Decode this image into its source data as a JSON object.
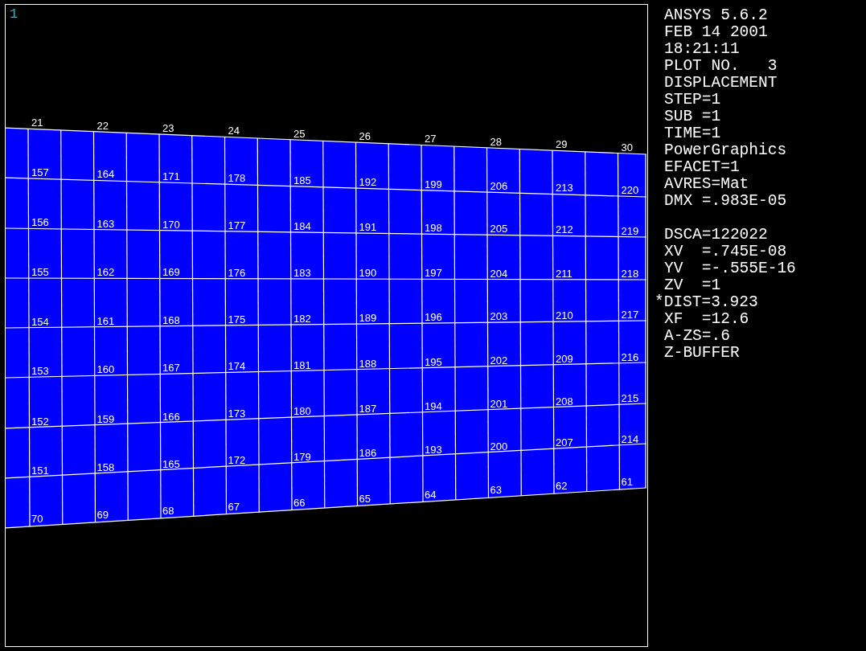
{
  "window_number": "1",
  "mesh": {
    "node_rows": [
      [
        "21",
        "22",
        "23",
        "24",
        "25",
        "26",
        "27",
        "28",
        "29",
        "30"
      ],
      [
        "157",
        "164",
        "171",
        "178",
        "185",
        "192",
        "199",
        "206",
        "213",
        "220"
      ],
      [
        "156",
        "163",
        "170",
        "177",
        "184",
        "191",
        "198",
        "205",
        "212",
        "219"
      ],
      [
        "155",
        "162",
        "169",
        "176",
        "183",
        "190",
        "197",
        "204",
        "211",
        "218"
      ],
      [
        "154",
        "161",
        "168",
        "175",
        "182",
        "189",
        "196",
        "203",
        "210",
        "217"
      ],
      [
        "153",
        "160",
        "167",
        "174",
        "181",
        "188",
        "195",
        "202",
        "209",
        "216"
      ],
      [
        "152",
        "159",
        "166",
        "173",
        "180",
        "187",
        "194",
        "201",
        "208",
        "215"
      ],
      [
        "151",
        "158",
        "165",
        "172",
        "179",
        "186",
        "193",
        "200",
        "207",
        "214"
      ],
      [
        "70",
        "69",
        "68",
        "67",
        "66",
        "65",
        "64",
        "63",
        "62",
        "61"
      ]
    ]
  },
  "legend": {
    "groups": [
      [
        {
          "text": "ANSYS 5.6.2",
          "kind": "plain"
        },
        {
          "text": "FEB 14 2001",
          "kind": "plain"
        },
        {
          "text": "18:21:11",
          "kind": "plain"
        },
        {
          "text": "PLOT NO.   3",
          "kind": "plain"
        },
        {
          "text": "DISPLACEMENT",
          "kind": "plain"
        },
        {
          "text": "STEP=1",
          "kind": "plain"
        },
        {
          "text": "SUB =1",
          "kind": "plain"
        },
        {
          "text": "TIME=1",
          "kind": "plain"
        },
        {
          "text": "PowerGraphics",
          "kind": "plain"
        },
        {
          "text": "EFACET=1",
          "kind": "plain"
        },
        {
          "text": "AVRES=Mat",
          "kind": "plain"
        },
        {
          "text": "DMX =.983E-05",
          "kind": "plain"
        }
      ],
      [
        {
          "text": "DSCA=122022",
          "kind": "plain"
        },
        {
          "text": "XV  =.745E-08",
          "kind": "plain"
        },
        {
          "text": "YV  =-.555E-16",
          "kind": "plain"
        },
        {
          "text": "ZV  =1",
          "kind": "plain"
        },
        {
          "text": "*DIST=3.923",
          "kind": "hanging"
        },
        {
          "text": "XF  =12.6",
          "kind": "plain"
        },
        {
          "text": "A-ZS=.6",
          "kind": "plain"
        },
        {
          "text": "Z-BUFFER",
          "kind": "plain"
        }
      ]
    ]
  }
}
